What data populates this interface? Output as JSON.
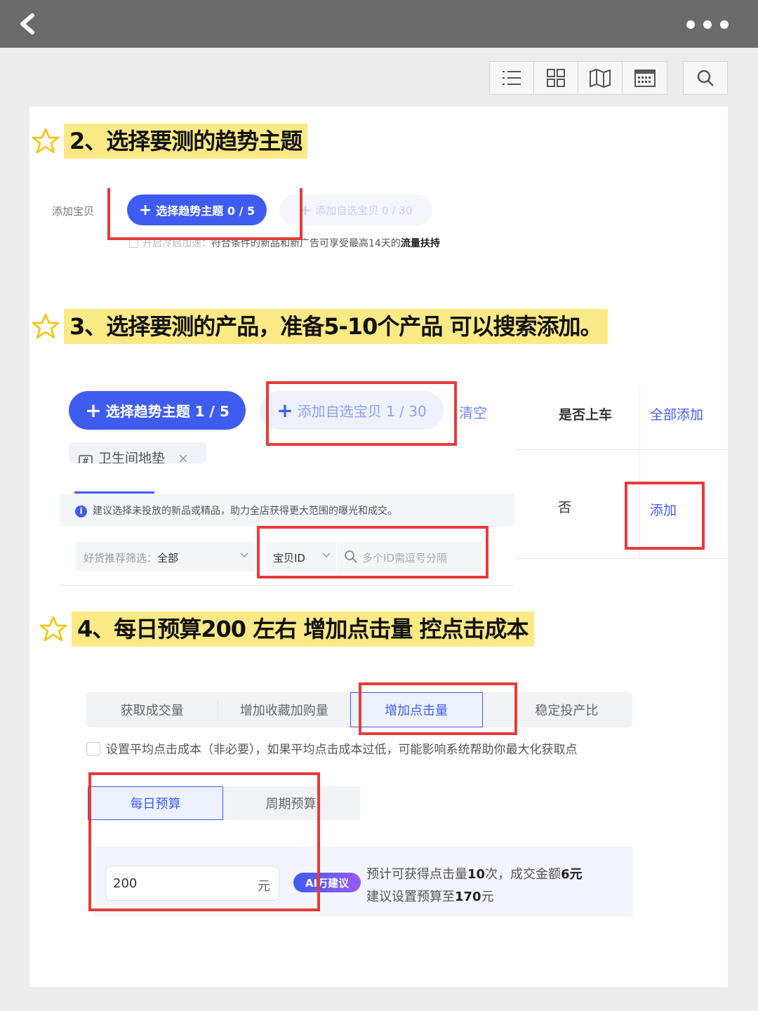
{
  "topbar": {
    "back_icon": "chevron-left-icon",
    "more_icon": "more-dots-icon"
  },
  "viewbar": {
    "buttons": [
      "list-view-icon",
      "grid-view-icon",
      "map-view-icon",
      "calendar-view-icon"
    ],
    "search_icon": "search-icon"
  },
  "step2": {
    "title": "2、选择要测的趋势主题",
    "add_item_label": "添加宝贝",
    "theme_button": "选择趋势主题 0 / 5",
    "custom_button": "添加自选宝贝 0 / 30",
    "note_faded": "开启冷启加速：",
    "note_text": "符合条件的新品和新广告可享受最高14天的",
    "note_bold": "流量扶持"
  },
  "step3": {
    "title": "3、选择要测的产品，准备5-10个产品 可以搜索添加。",
    "theme_button": "选择趋势主题 1 / 5",
    "custom_button": "添加自选宝贝 1 / 30",
    "clear_link": "清空",
    "tag_label": "卫生间地垫",
    "tag_close": "×",
    "info_text": "建议选择未投放的新品或精品，助力全店获得更大范围的曝光和成交。",
    "filter_label": "好货推荐筛选：",
    "filter_value": "全部",
    "id_select": "宝贝ID",
    "search_placeholder": "多个ID需逗号分隔",
    "col_header_listed": "是否上车",
    "col_header_add_all": "全部添加",
    "row_listed": "否",
    "row_add": "添加"
  },
  "step4": {
    "title": "4、每日预算200 左右 增加点击量 控点击成本",
    "goal_tabs": [
      "获取成交量",
      "增加收藏加购量",
      "增加点击量",
      "稳定投产比"
    ],
    "active_goal": "增加点击量",
    "checkbox_label": "设置平均点击成本（非必要），如果平均点击成本过低，可能影响系统帮助你最大化获取点",
    "budget_tabs": [
      "每日预算",
      "周期预算"
    ],
    "budget_value": "200",
    "budget_unit": "元",
    "ai_badge": "AI万建议",
    "estimate_prefix": "预计可获得点击量",
    "estimate_clicks": "10",
    "estimate_mid": "次，成交金额",
    "estimate_amount": "6元",
    "suggest_prefix": "建议设置预算至",
    "suggest_value": "170",
    "suggest_unit": "元"
  },
  "colors": {
    "accent": "#3e5cf0",
    "highlight": "#fbe986",
    "annotation": "#e53b3b",
    "star": "#f2c200"
  }
}
